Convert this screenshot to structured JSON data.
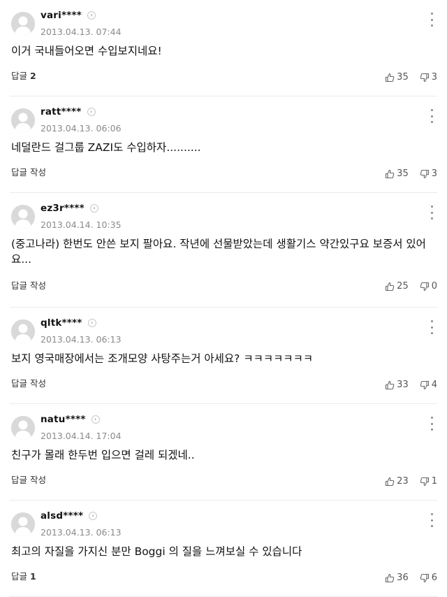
{
  "comments": [
    {
      "nickname": "vari****",
      "date": "2013.04.13. 07:44",
      "text": "이거 국내들어오면 수입보지네요!",
      "reply_label": "답글",
      "reply_count": "2",
      "likes": "35",
      "dislikes": "3"
    },
    {
      "nickname": "ratt****",
      "date": "2013.04.13. 06:06",
      "text": "네덜란드 걸그룹 ZAZI도 수입하자..........",
      "reply_label": "답글 작성",
      "reply_count": "",
      "likes": "35",
      "dislikes": "3"
    },
    {
      "nickname": "ez3r****",
      "date": "2013.04.14. 10:35",
      "text": "(중고나라) 한번도 안쓴 보지 팔아요. 작년에 선물받았는데 생활기스 약간있구요 보증서 있어요...",
      "reply_label": "답글 작성",
      "reply_count": "",
      "likes": "25",
      "dislikes": "0"
    },
    {
      "nickname": "qltk****",
      "date": "2013.04.13. 06:13",
      "text": "보지 영국매장에서는 조개모양 사탕주는거 아세요? ㅋㅋㅋㅋㅋㅋㅋ",
      "reply_label": "답글 작성",
      "reply_count": "",
      "likes": "33",
      "dislikes": "4"
    },
    {
      "nickname": "natu****",
      "date": "2013.04.14. 17:04",
      "text": "친구가 몰래 한두번 입으면 걸레 되겠네..",
      "reply_label": "답글 작성",
      "reply_count": "",
      "likes": "23",
      "dislikes": "1"
    },
    {
      "nickname": "alsd****",
      "date": "2013.04.13. 06:13",
      "text": "최고의 자질을 가지신 분만 Boggi 의 질을 느껴보실 수 있습니다",
      "reply_label": "답글",
      "reply_count": "1",
      "likes": "36",
      "dislikes": "6"
    }
  ]
}
